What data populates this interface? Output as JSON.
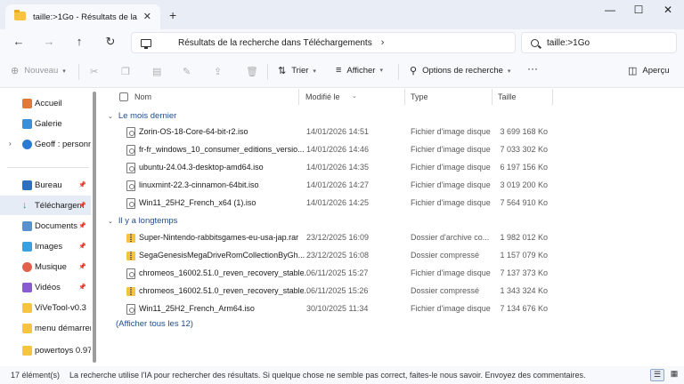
{
  "window": {
    "tab_title": "taille:>1Go - Résultats de la re",
    "tab_close": "✕",
    "new_tab": "+",
    "minimize": "—",
    "maximize": "☐",
    "close": "✕"
  },
  "nav": {
    "back": "←",
    "forward": "→",
    "up": "↑",
    "refresh": "↻",
    "breadcrumb": "Résultats de la recherche dans Téléchargements",
    "breadcrumb_chevron": "›",
    "search_value": "taille:>1Go"
  },
  "commands": {
    "new_label": "Nouveau",
    "sort_label": "Trier",
    "view_label": "Afficher",
    "search_options_label": "Options de recherche",
    "more": "···",
    "preview_label": "Aperçu"
  },
  "sidebar": {
    "items": [
      {
        "label": "Accueil",
        "icon": "home-icon",
        "color": "#e07a3a"
      },
      {
        "label": "Galerie",
        "icon": "gallery-icon",
        "color": "#3a8fd8"
      },
      {
        "label": "Geoff : personne",
        "icon": "cloud-icon",
        "color": "#2b7bd1"
      },
      {
        "label": "Bureau",
        "icon": "desktop-icon",
        "color": "#2f6fbf"
      },
      {
        "label": "Téléchargem",
        "icon": "download-icon",
        "color": "#2a9d8f"
      },
      {
        "label": "Documents",
        "icon": "documents-icon",
        "color": "#5a8fd0"
      },
      {
        "label": "Images",
        "icon": "images-icon",
        "color": "#3aa0e0"
      },
      {
        "label": "Musique",
        "icon": "music-icon",
        "color": "#e0604a"
      },
      {
        "label": "Vidéos",
        "icon": "videos-icon",
        "color": "#8a5ad0"
      },
      {
        "label": "ViVeTool-v0.3",
        "icon": "folder-icon",
        "color": "#f6c343"
      },
      {
        "label": "menu démarrer",
        "icon": "folder-icon",
        "color": "#f6c343"
      },
      {
        "label": "powertoys 0.97",
        "icon": "folder-icon",
        "color": "#f6c343"
      }
    ]
  },
  "columns": {
    "name": "Nom",
    "modified": "Modifié le",
    "type": "Type",
    "size": "Taille"
  },
  "groups": [
    {
      "label": "Le mois dernier",
      "files": [
        {
          "name": "Zorin-OS-18-Core-64-bit-r2.iso",
          "date": "14/01/2026 14:51",
          "type": "Fichier d'image disque",
          "size": "3 699 168 Ko",
          "kind": "iso"
        },
        {
          "name": "fr-fr_windows_10_consumer_editions_versio...",
          "date": "14/01/2026 14:46",
          "type": "Fichier d'image disque",
          "size": "7 033 302 Ko",
          "kind": "iso"
        },
        {
          "name": "ubuntu-24.04.3-desktop-amd64.iso",
          "date": "14/01/2026 14:35",
          "type": "Fichier d'image disque",
          "size": "6 197 156 Ko",
          "kind": "iso"
        },
        {
          "name": "linuxmint-22.3-cinnamon-64bit.iso",
          "date": "14/01/2026 14:27",
          "type": "Fichier d'image disque",
          "size": "3 019 200 Ko",
          "kind": "iso"
        },
        {
          "name": "Win11_25H2_French_x64 (1).iso",
          "date": "14/01/2026 14:25",
          "type": "Fichier d'image disque",
          "size": "7 564 910 Ko",
          "kind": "iso"
        }
      ]
    },
    {
      "label": "Il y a longtemps",
      "files": [
        {
          "name": "Super-Nintendo-rabbitsgames-eu-usa-jap.rar",
          "date": "23/12/2025 16:09",
          "type": "Dossier d'archive co...",
          "size": "1 982 012 Ko",
          "kind": "zip"
        },
        {
          "name": "SegaGenesisMegaDriveRomCollectionByGh...",
          "date": "23/12/2025 16:08",
          "type": "Dossier compressé",
          "size": "1 157 079 Ko",
          "kind": "zip"
        },
        {
          "name": "chromeos_16002.51.0_reven_recovery_stable...",
          "date": "06/11/2025 15:27",
          "type": "Fichier d'image disque",
          "size": "7 137 373 Ko",
          "kind": "iso"
        },
        {
          "name": "chromeos_16002.51.0_reven_recovery_stable...",
          "date": "06/11/2025 15:26",
          "type": "Dossier compressé",
          "size": "1 343 324 Ko",
          "kind": "zip"
        },
        {
          "name": "Win11_25H2_French_Arm64.iso",
          "date": "30/10/2025 11:34",
          "type": "Fichier d'image disque",
          "size": "7 134 676 Ko",
          "kind": "iso"
        }
      ]
    }
  ],
  "show_all": "(Afficher tous les 12)",
  "status": {
    "count": "17 élément(s)",
    "message": "La recherche utilise l'IA pour rechercher des résultats. Si quelque chose ne semble pas correct, faites-le nous savoir.  Envoyez des commentaires."
  }
}
